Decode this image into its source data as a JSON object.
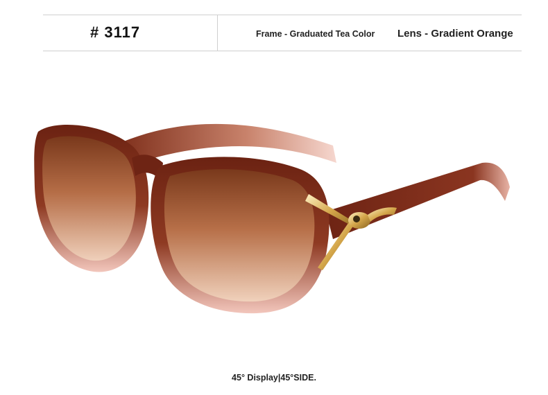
{
  "header": {
    "model": "# 3117",
    "frame": "Frame - Graduated Tea Color",
    "lens": "Lens - Gradient Orange"
  },
  "product_image": {
    "icon": "sunglasses-icon",
    "colors": {
      "frame_dark": "#6b2212",
      "frame_light": "#f2c6bc",
      "lens_top": "#7a3a1c",
      "lens_bottom": "#f1d3bd",
      "hinge_gold": "#d4a64a"
    }
  },
  "caption": "45° Display|45°SIDE."
}
